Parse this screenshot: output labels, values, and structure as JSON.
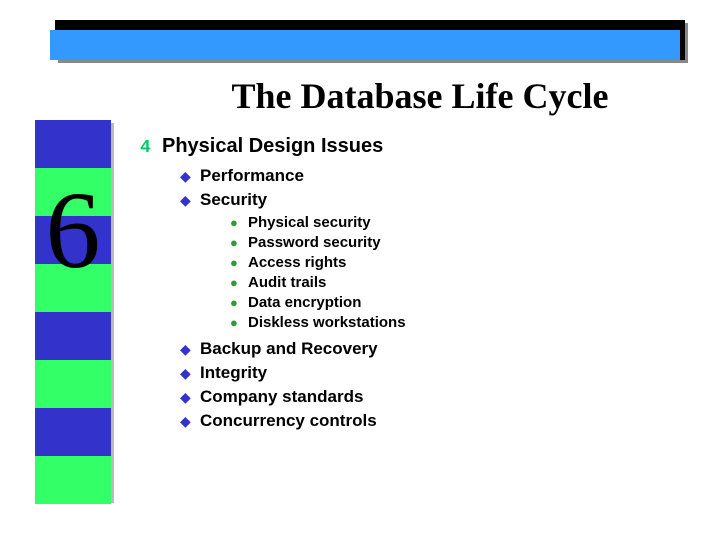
{
  "title": "The Database Life Cycle",
  "chapter_number": "6",
  "heading": {
    "bullet": "4",
    "text": "Physical Design Issues"
  },
  "level2_top": [
    {
      "bullet": "◆",
      "text": "Performance"
    },
    {
      "bullet": "◆",
      "text": "Security"
    }
  ],
  "level3": [
    {
      "bullet": "●",
      "text": "Physical security"
    },
    {
      "bullet": "●",
      "text": "Password security"
    },
    {
      "bullet": "●",
      "text": "Access rights"
    },
    {
      "bullet": "●",
      "text": "Audit trails"
    },
    {
      "bullet": "●",
      "text": "Data encryption"
    },
    {
      "bullet": "●",
      "text": "Diskless workstations"
    }
  ],
  "level2_bottom": [
    {
      "bullet": "◆",
      "text": "Backup and Recovery"
    },
    {
      "bullet": "◆",
      "text": "Integrity"
    },
    {
      "bullet": "◆",
      "text": "Company standards"
    },
    {
      "bullet": "◆",
      "text": "Concurrency controls"
    }
  ]
}
